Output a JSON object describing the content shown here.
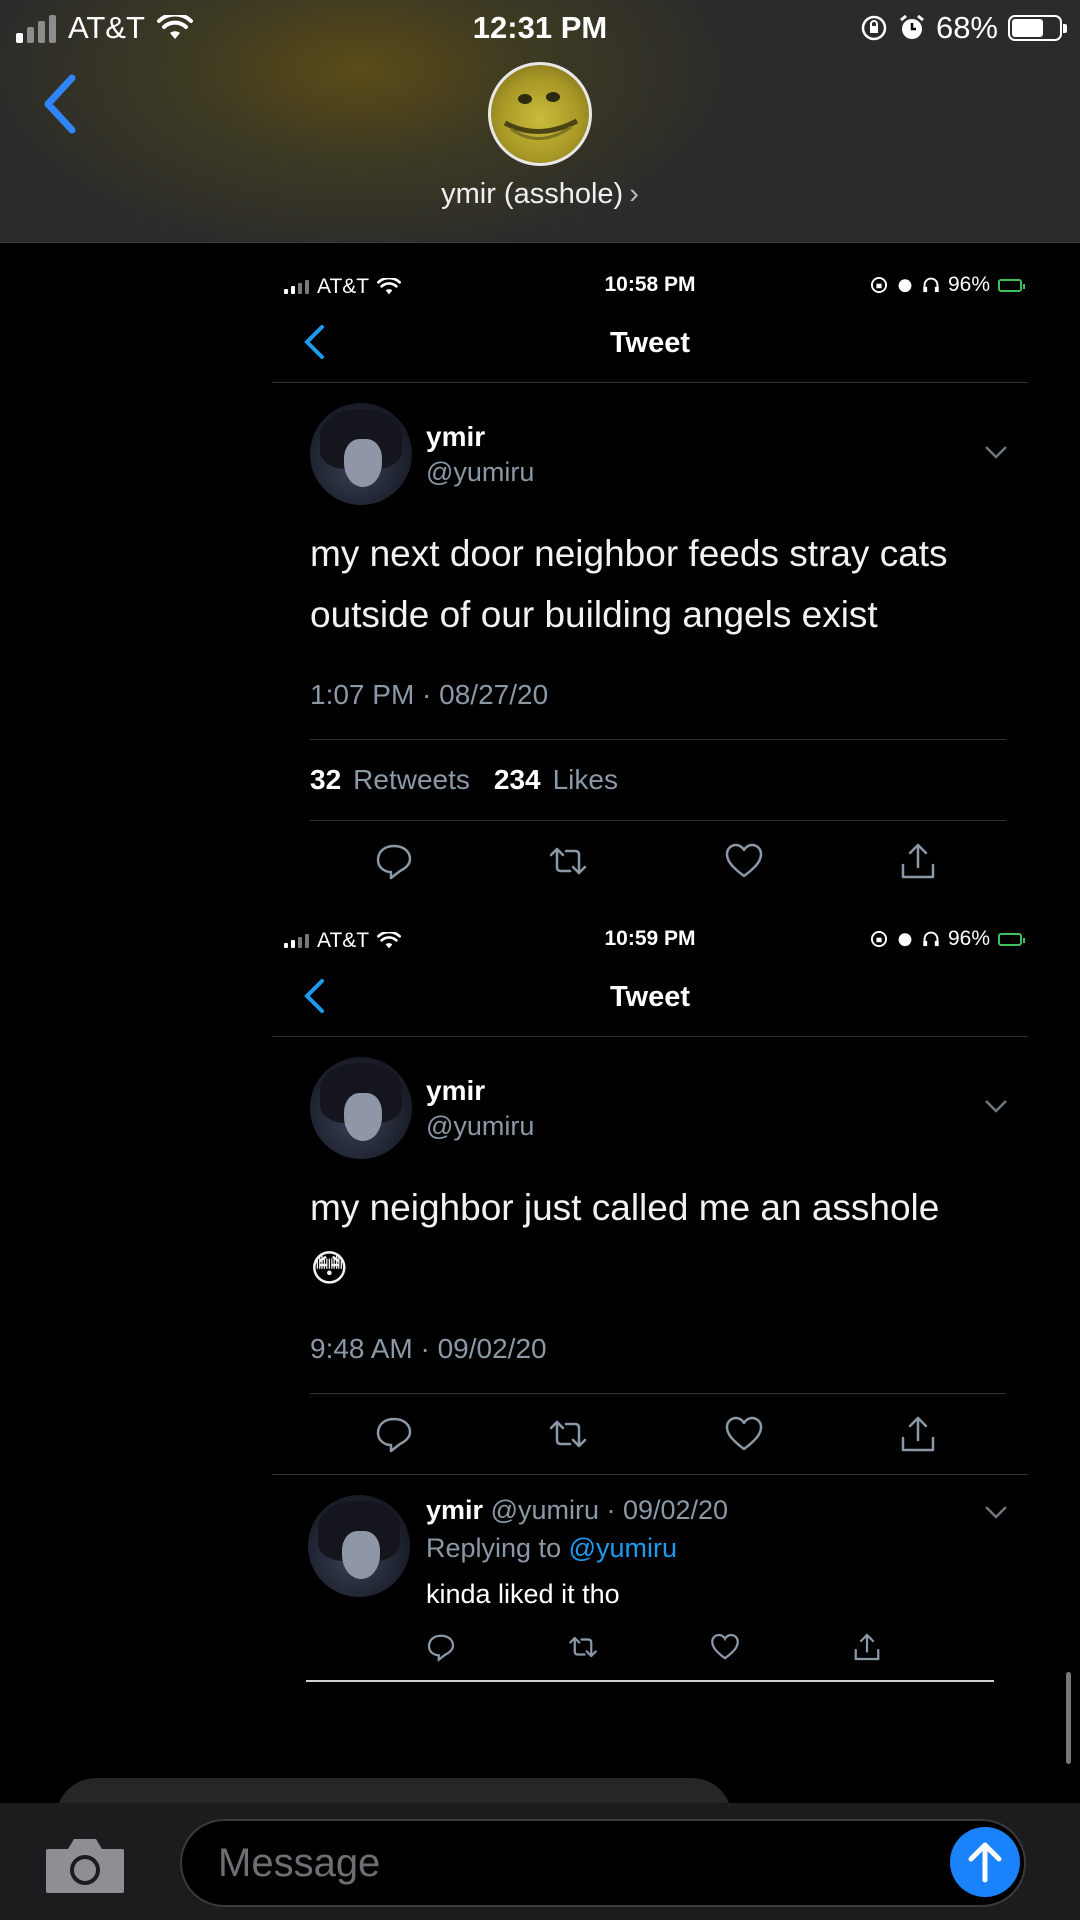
{
  "status_bar": {
    "carrier": "AT&T",
    "time": "12:31 PM",
    "battery": "68%",
    "battery_level": 0.68
  },
  "conversation": {
    "contact_name": "ymir (asshole)",
    "chevron": "›"
  },
  "embedded_screens": [
    {
      "status_bar": {
        "carrier": "AT&T",
        "time": "10:58 PM",
        "battery": "96%"
      },
      "nav_title": "Tweet",
      "author_name": "ymir",
      "author_handle": "@yumiru",
      "text": "my next door neighbor feeds stray cats outside of our building angels exist",
      "timestamp": "1:07 PM · 08/27/20",
      "retweets": "32",
      "retweets_label": "Retweets",
      "likes": "234",
      "likes_label": "Likes"
    },
    {
      "status_bar": {
        "carrier": "AT&T",
        "time": "10:59 PM",
        "battery": "96%"
      },
      "nav_title": "Tweet",
      "author_name": "ymir",
      "author_handle": "@yumiru",
      "text": "my neighbor just called me an asshole 😳",
      "timestamp": "9:48 AM · 09/02/20",
      "reply": {
        "author_name": "ymir",
        "meta": "@yumiru · 09/02/20",
        "replying_prefix": "Replying to",
        "replying_to": "@yumiru",
        "text": "kinda liked it tho"
      }
    }
  ],
  "composer": {
    "placeholder": "Message"
  },
  "icons": {
    "camera": "camera-icon",
    "send": "arrow-up-icon",
    "reply": "reply-icon",
    "retweet": "retweet-icon",
    "like": "heart-icon",
    "share": "share-icon"
  },
  "colors": {
    "accent": "#1a82fb",
    "twitter_blue": "#1d9bf0",
    "secondary_text": "#8b98a5"
  }
}
